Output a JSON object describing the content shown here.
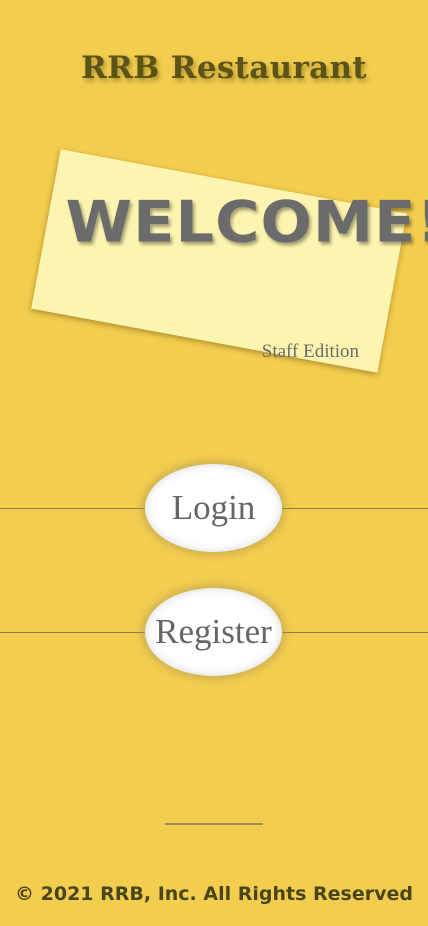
{
  "header": {
    "title": "RRB Restaurant"
  },
  "welcome_card": {
    "heading": "WELCOME!",
    "subtitle": "Staff Edition"
  },
  "actions": {
    "login_label": "Login",
    "register_label": "Register"
  },
  "footer": {
    "copyright": "© 2021 RRB, Inc. All Rights Reserved"
  },
  "colors": {
    "background": "#f3cd4e",
    "card": "#fdf4b0",
    "title": "#5c5316",
    "text_gray": "#6b6b6b",
    "button_bg": "#ffffff"
  }
}
